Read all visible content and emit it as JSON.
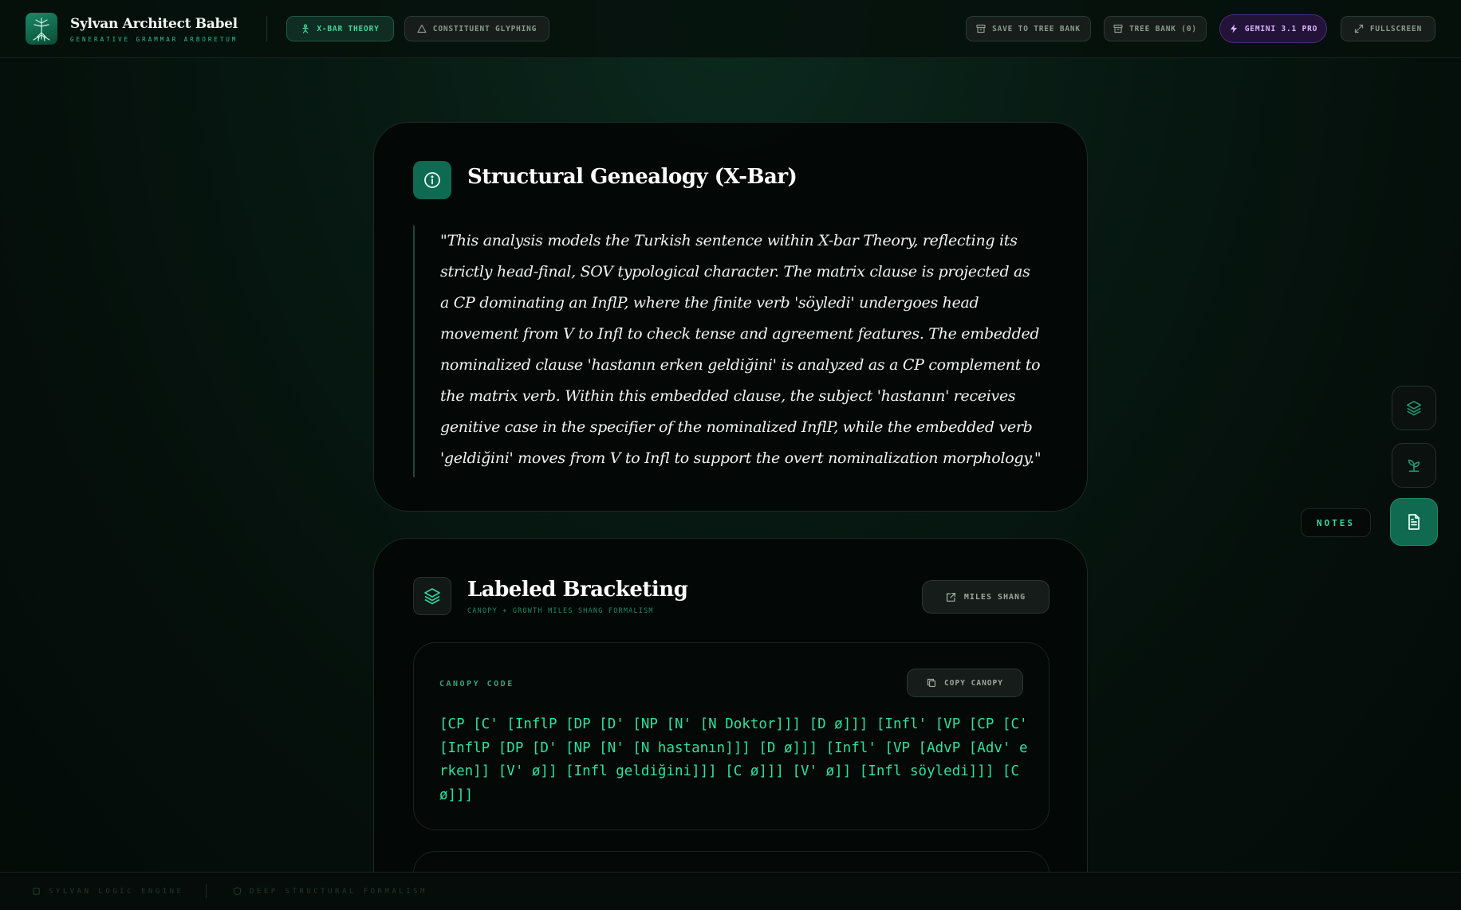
{
  "header": {
    "brand_title": "Sylvan Architect Babel",
    "brand_subtitle": "GENERATIVE GRAMMAR ARBORETUM",
    "tabs": [
      {
        "label": "X-BAR THEORY",
        "active": true
      },
      {
        "label": "CONSTITUENT GLYPHING",
        "active": false
      }
    ],
    "actions": {
      "save": "SAVE TO TREE BANK",
      "tree_bank": "TREE BANK (0)",
      "model": "GEMINI 3.1 PRO",
      "fullscreen": "FULLSCREEN"
    }
  },
  "genealogy": {
    "title": "Structural Genealogy (X-Bar)",
    "quote": "\"This analysis models the Turkish sentence within X-bar Theory, reflecting its strictly head-final, SOV typological character. The matrix clause is projected as a CP dominating an InflP, where the finite verb 'söyledi' undergoes head movement from V to Infl to check tense and agreement features. The embedded nominalized clause 'hastanın erken geldiğini' is analyzed as a CP complement to the matrix verb. Within this embedded clause, the subject 'hastanın' receives genitive case in the specifier of the nominalized InflP, while the embedded verb 'geldiğini' moves from V to Infl to support the overt nominalization morphology.\""
  },
  "bracketing": {
    "title": "Labeled Bracketing",
    "subtitle": "CANOPY + GROWTH MILES SHANG FORMALISM",
    "miles_button": "MILES SHANG",
    "canopy_label": "CANOPY CODE",
    "copy_button": "COPY CANOPY",
    "canopy_code": "[CP [C' [InflP [DP [D' [NP [N' [N Doktor]]] [D ø]]] [Infl' [VP [CP [C' [InflP [DP [D' [NP [N' [N hastanın]]] [D ø]]] [Infl' [VP [AdvP [Adv' erken]] [V' ø]] [Infl geldiğini]]] [C ø]]] [V' ø]] [Infl söyledi]]] [C ø]]]"
  },
  "dock": {
    "notes_label": "NOTES"
  },
  "footer": {
    "left": "SYLVAN LOGIC ENGINE",
    "right": "DEEP STRUCTURAL FORMALISM"
  },
  "colors": {
    "accent": "#2ee0a0",
    "brand_green": "#0e6a50",
    "gemini_purple": "#241338"
  }
}
